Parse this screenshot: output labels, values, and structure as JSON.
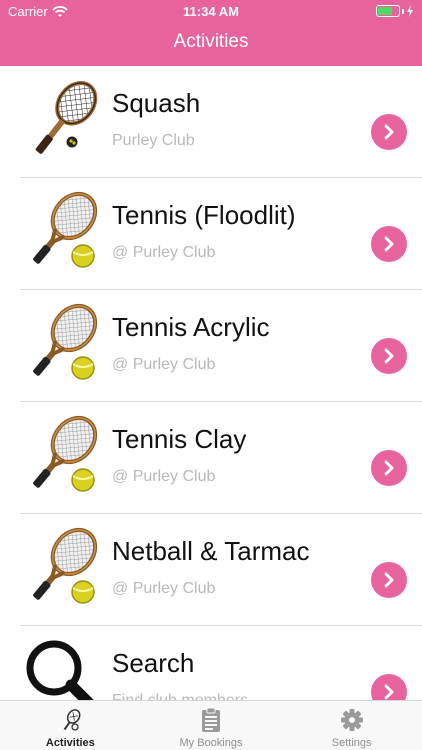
{
  "status_bar": {
    "carrier": "Carrier",
    "time": "11:34 AM"
  },
  "header": {
    "title": "Activities"
  },
  "activities": [
    {
      "name": "Squash",
      "subtitle": "Purley Club",
      "icon": "squash-racket-icon"
    },
    {
      "name": "Tennis (Floodlit)",
      "subtitle": "@ Purley Club",
      "icon": "tennis-racket-icon"
    },
    {
      "name": "Tennis Acrylic",
      "subtitle": "@ Purley Club",
      "icon": "tennis-racket-icon"
    },
    {
      "name": "Tennis Clay",
      "subtitle": "@ Purley Club",
      "icon": "tennis-racket-icon"
    },
    {
      "name": "Netball & Tarmac",
      "subtitle": "@ Purley Club",
      "icon": "tennis-racket-icon"
    },
    {
      "name": "Search",
      "subtitle": "Find club members",
      "icon": "magnifier-icon"
    }
  ],
  "tabbar": {
    "items": [
      {
        "label": "Activities",
        "icon": "racket-tab-icon",
        "active": true
      },
      {
        "label": "My Bookings",
        "icon": "clipboard-icon",
        "active": false
      },
      {
        "label": "Settings",
        "icon": "gear-icon",
        "active": false
      }
    ]
  },
  "colors": {
    "accent": "#e8629b",
    "subtitle": "#b9b9b9",
    "divider": "#dcdcdc",
    "tab_bg": "#f8f8f8"
  }
}
